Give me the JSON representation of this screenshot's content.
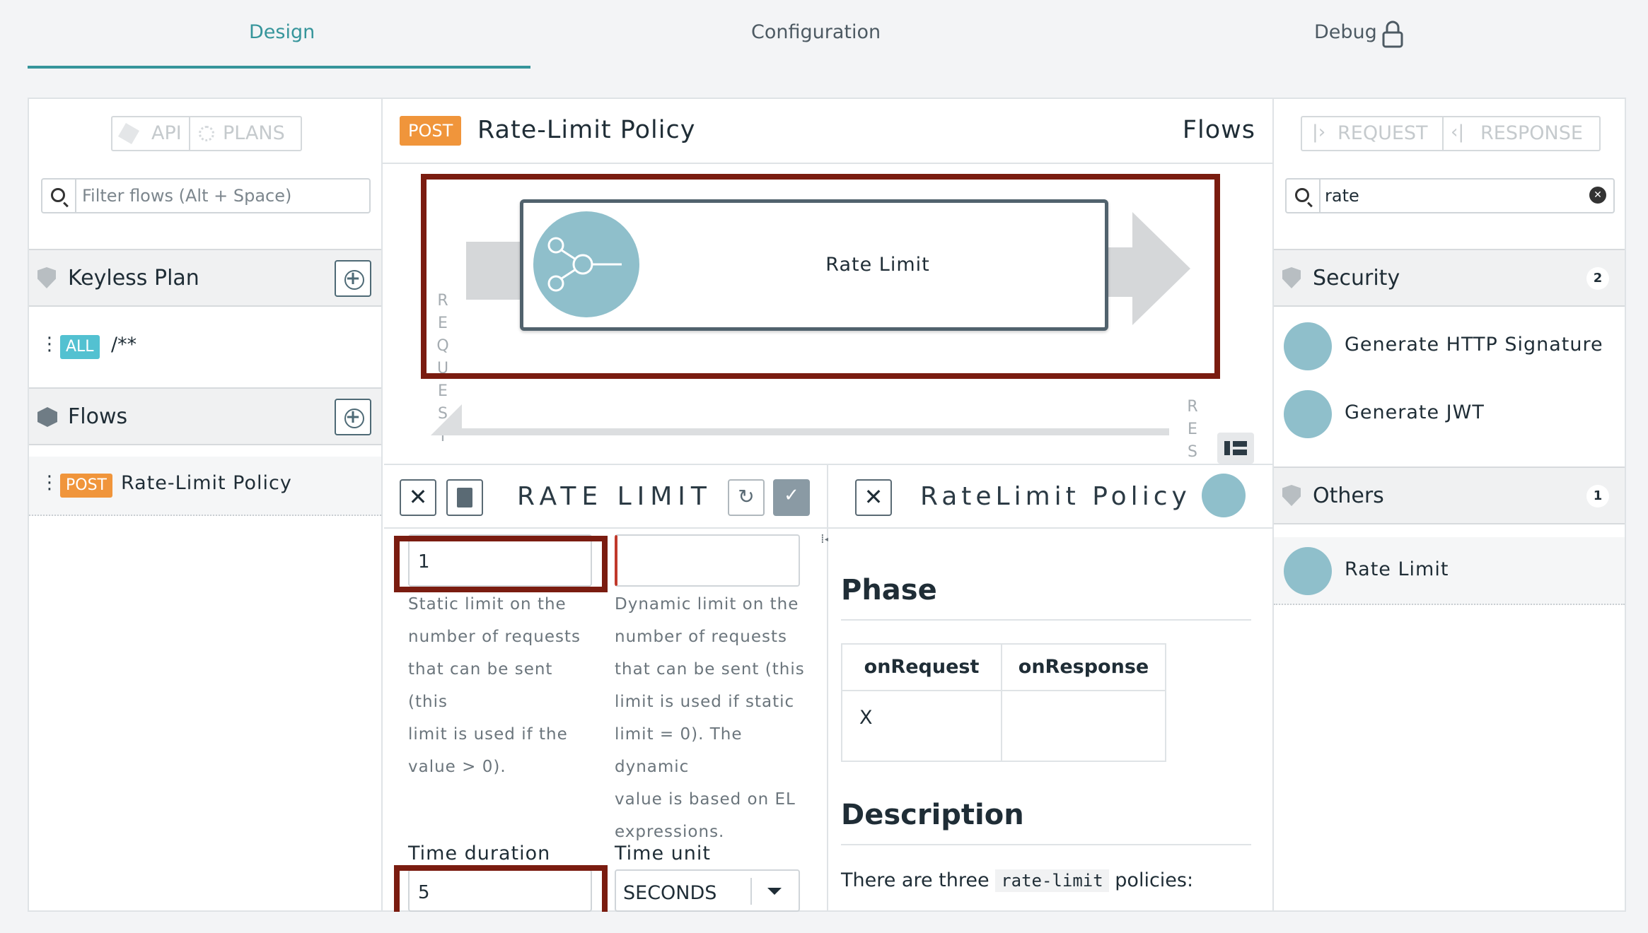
{
  "tabs": [
    {
      "label": "Design"
    },
    {
      "label": "Configuration"
    },
    {
      "label": "Debug"
    }
  ],
  "left": {
    "api_label": "API",
    "plans_label": "PLANS",
    "filter_placeholder": "Filter flows (Alt + Space)",
    "plan_title": "Keyless Plan",
    "plan_flow": {
      "method": "ALL",
      "path": "/**"
    },
    "flows_title": "Flows",
    "flow_item": {
      "method": "POST",
      "name": "Rate-Limit Policy"
    }
  },
  "center": {
    "method": "POST",
    "title": "Rate-Limit Policy",
    "flows_label": "Flows",
    "request_letters": [
      "R",
      "E",
      "Q",
      "U",
      "E",
      "S",
      "T"
    ],
    "response_letters": [
      "R",
      "E",
      "S"
    ],
    "policy_name": "Rate Limit"
  },
  "form": {
    "title": "RATE LIMIT",
    "static_limit_value": "1",
    "static_limit_help": [
      "Static limit on the",
      "number of requests",
      "that can be sent (this",
      "limit is used if the",
      "value > 0)."
    ],
    "dynamic_limit_value": "",
    "dynamic_limit_help": [
      "Dynamic limit on the",
      "number of requests",
      "that can be sent (this",
      "limit is used if static",
      "limit = 0). The dynamic",
      "value is based on EL",
      "expressions."
    ],
    "time_duration_label": "Time duration",
    "time_duration_value": "5",
    "time_unit_label": "Time unit",
    "time_unit_value": "SECONDS"
  },
  "doc": {
    "title": "RateLimit Policy",
    "phase_heading": "Phase",
    "phase_cols": [
      "onRequest",
      "onResponse"
    ],
    "phase_values": [
      "X",
      ""
    ],
    "description_heading": "Description",
    "description_text_pre": "There are three",
    "description_code": "rate-limit",
    "description_text_post": "policies:"
  },
  "right": {
    "request_label": "REQUEST",
    "response_label": "RESPONSE",
    "search_value": "rate",
    "security_title": "Security",
    "security_count": "2",
    "security_items": [
      "Generate HTTP Signature",
      "Generate JWT"
    ],
    "others_title": "Others",
    "others_count": "1",
    "others_items": [
      "Rate Limit"
    ]
  },
  "colors": {
    "accent": "#36959b",
    "post": "#f0953b",
    "all": "#53c1d1",
    "highlight": "#7a1c10",
    "policy_icon": "#8fbfcb"
  }
}
